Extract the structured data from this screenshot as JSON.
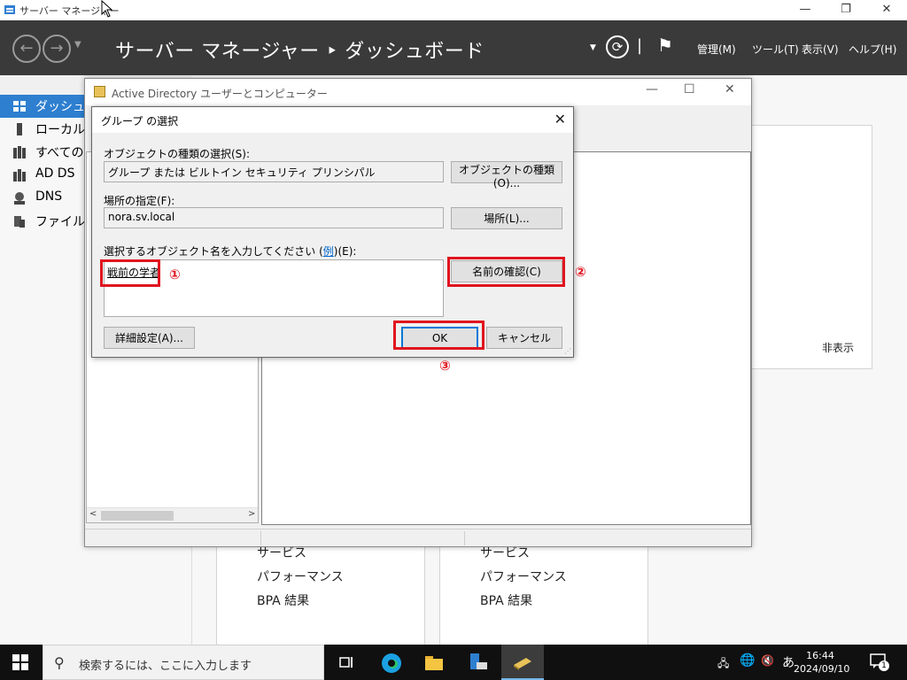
{
  "server_manager": {
    "title": "サーバー マネージャー",
    "breadcrumb": "サーバー マネージャー ‣ ダッシュボード",
    "menu": [
      "管理(M)",
      "ツール(T)",
      "表示(V)",
      "ヘルプ(H)"
    ],
    "sidebar": [
      {
        "label": "ダッシュボード",
        "active": true
      },
      {
        "label": "ローカル サ"
      },
      {
        "label": "すべてのサ"
      },
      {
        "label": "AD DS"
      },
      {
        "label": "DNS"
      },
      {
        "label": "ファイル サ"
      }
    ],
    "tile_left": [
      "サービス",
      "パフォーマンス",
      "BPA 結果"
    ],
    "tile_right": [
      "サービス",
      "パフォーマンス",
      "BPA 結果"
    ],
    "hide_label": "非表示"
  },
  "ad_window": {
    "title": "Active Directory ユーザーとコンピューター"
  },
  "dialog": {
    "title": "グループ の選択",
    "object_type_label": "オブジェクトの種類の選択(S):",
    "object_type_value": "グループ または ビルトイン セキュリティ プリンシパル",
    "object_type_button": "オブジェクトの種類(O)...",
    "location_label": "場所の指定(F):",
    "location_value": "nora.sv.local",
    "location_button": "場所(L)...",
    "enter_label_prefix": "選択するオブジェクト名を入力してください (",
    "example_link": "例",
    "enter_label_suffix": ")(E):",
    "object_name_value": "戦前の学者",
    "check_names_button": "名前の確認(C)",
    "advanced_button": "詳細設定(A)...",
    "ok_button": "OK",
    "cancel_button": "キャンセル"
  },
  "annotations": [
    "①",
    "②",
    "③"
  ],
  "taskbar": {
    "search_placeholder": "検索するには、ここに入力します",
    "ime_label": "あ",
    "time": "16:44",
    "date": "2024/09/10",
    "notification_count": "1"
  },
  "colors": {
    "sidebar_active": "#2e7fd0",
    "header_bg": "#3a3a3a",
    "annotation_red": "#e0141e",
    "default_button_border": "#0078d7"
  }
}
